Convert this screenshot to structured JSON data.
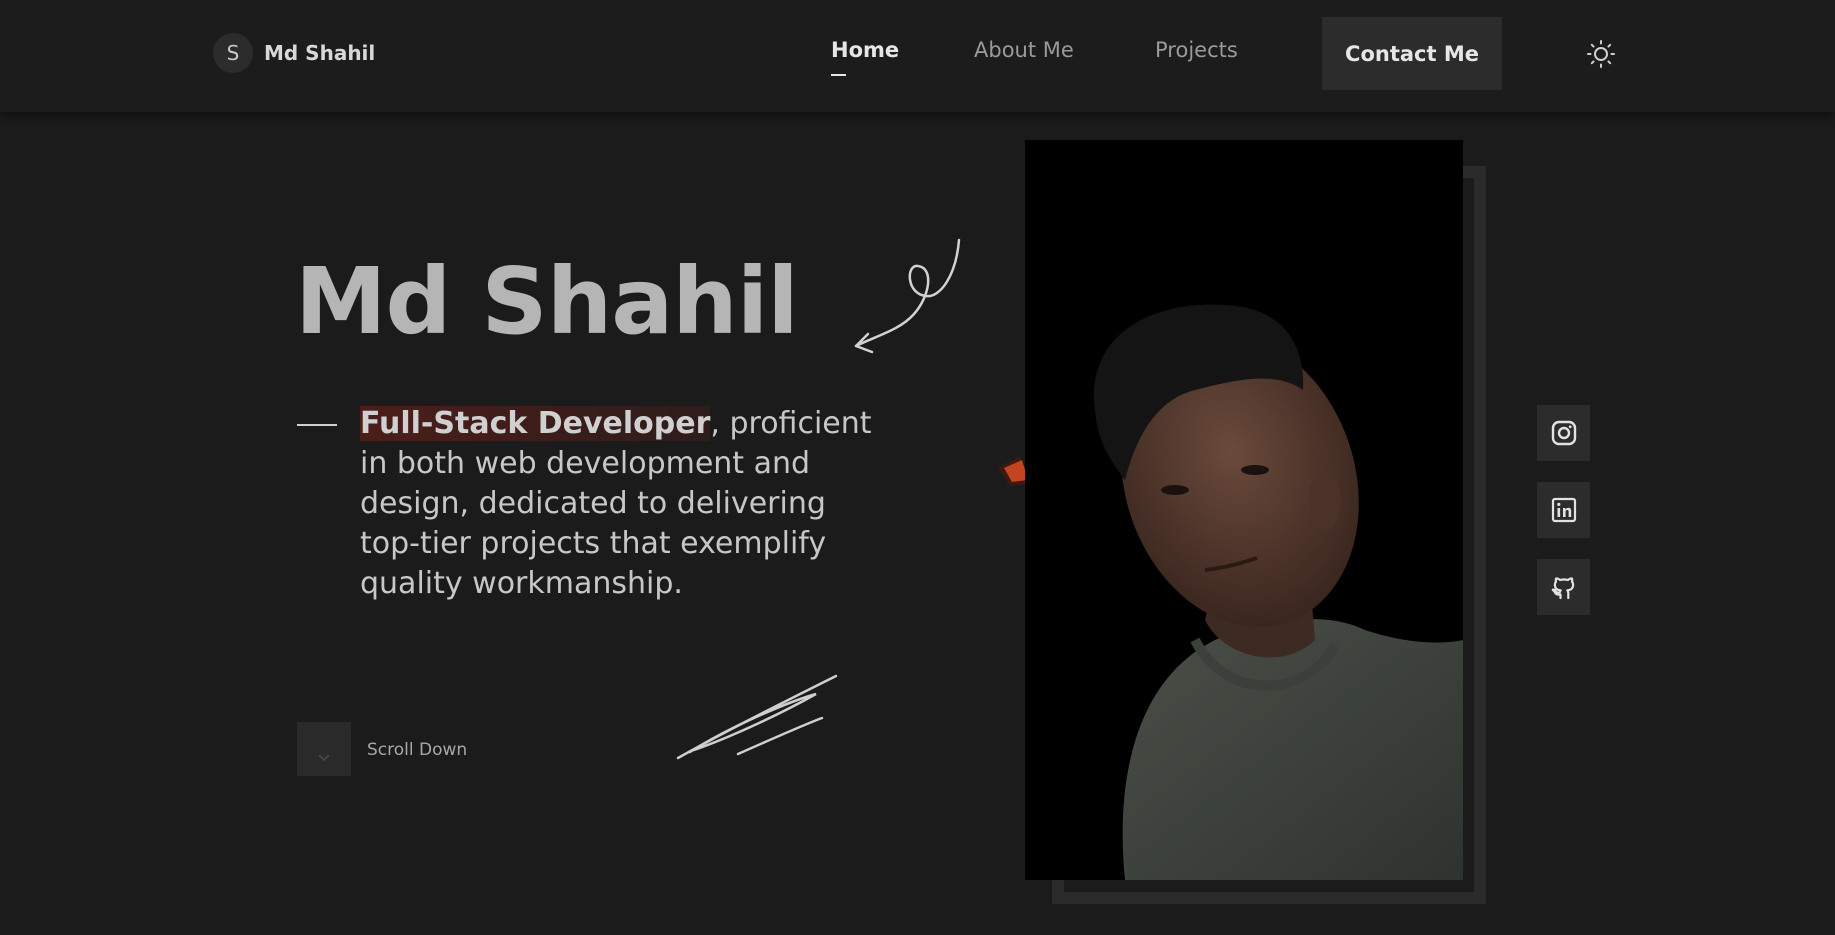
{
  "nav": {
    "brand_initial": "S",
    "brand_name": "Md Shahil",
    "links": [
      {
        "label": "Home",
        "active": true
      },
      {
        "label": "About Me",
        "active": false
      },
      {
        "label": "Projects",
        "active": false
      }
    ],
    "contact_label": "Contact Me",
    "theme_icon": "sun-icon"
  },
  "hero": {
    "title": "Md Shahil",
    "tagline_highlight": "Full-Stack Developer",
    "tagline_rest": ", proficient in both web development and design, dedicated to delivering top-tier projects that exemplify quality workmanship.",
    "scroll_label": "Scroll Down",
    "scroll_icon": "chevron-down-icon"
  },
  "social": [
    {
      "name": "instagram",
      "icon": "instagram-icon"
    },
    {
      "name": "linkedin",
      "icon": "linkedin-icon"
    },
    {
      "name": "github",
      "icon": "github-icon"
    }
  ],
  "colors": {
    "background": "#1b1b1b",
    "navbar": "#1c1c1c",
    "button": "#2c2c2c",
    "accent_orange": "#c2451f",
    "highlight": "#4a2520"
  }
}
